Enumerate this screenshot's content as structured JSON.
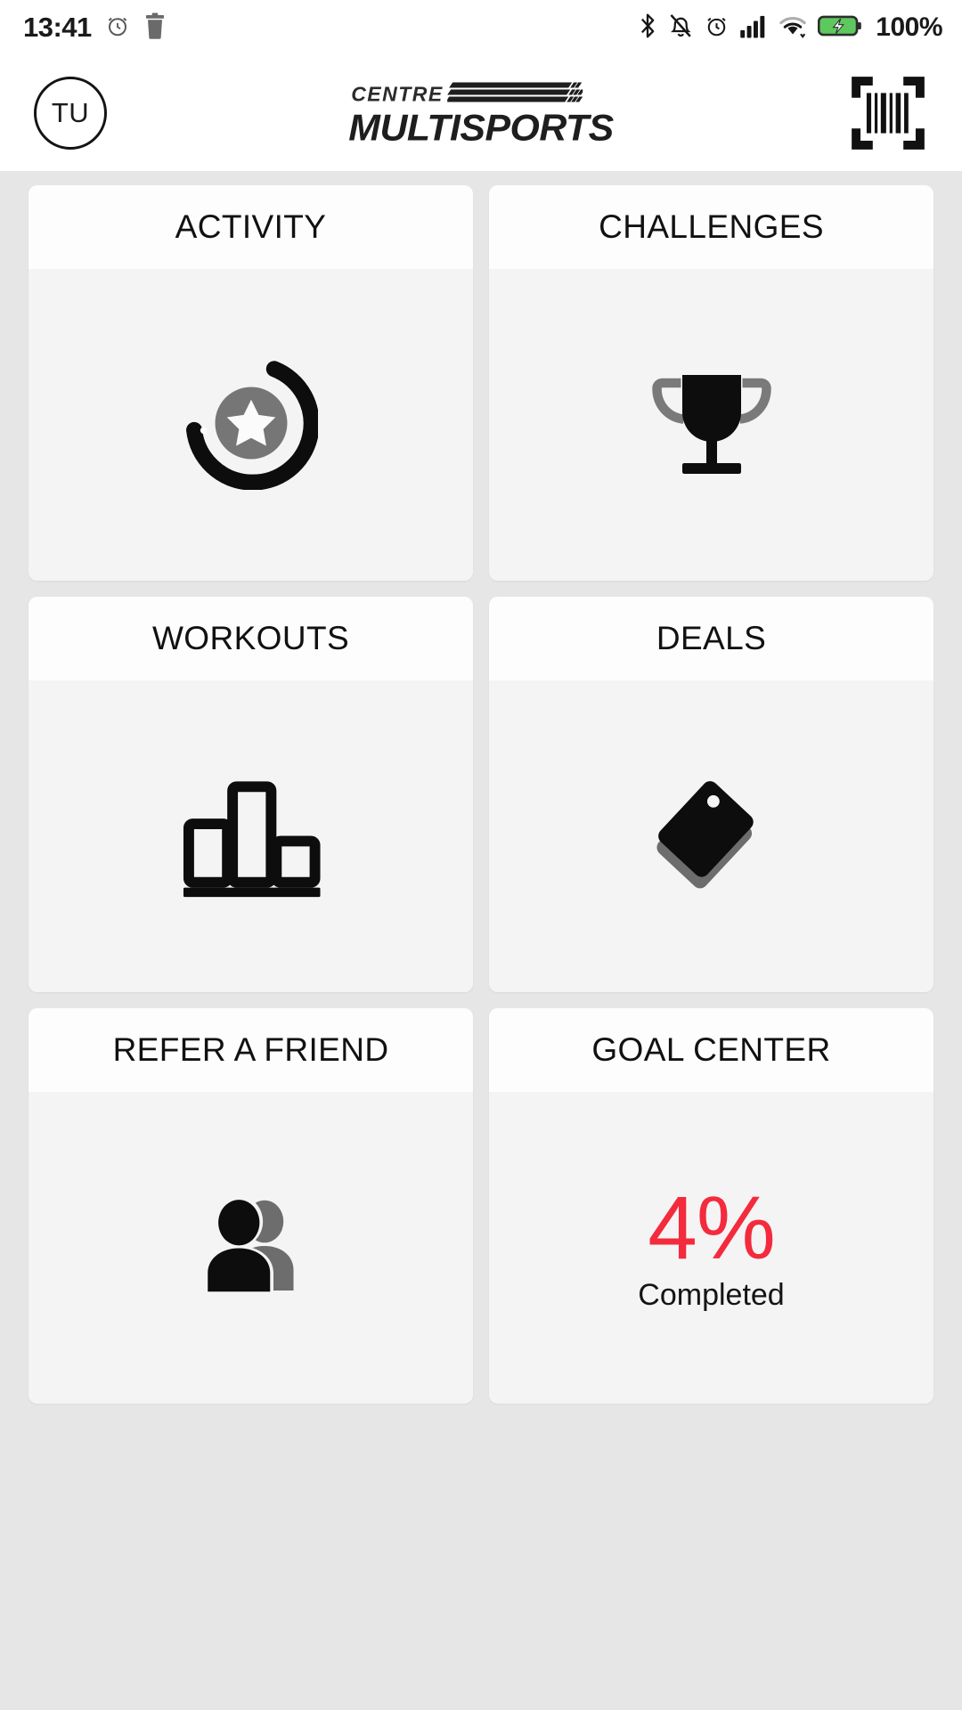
{
  "status_bar": {
    "time": "13:41",
    "battery_percent": "100%",
    "left_icons": [
      "alarm-icon",
      "trash-icon"
    ],
    "right_icons": [
      "bluetooth-icon",
      "mute-icon",
      "alarm-icon",
      "cellular-signal-icon",
      "wifi-icon",
      "battery-charging-icon"
    ]
  },
  "header": {
    "avatar_initials": "TU",
    "brand_line1": "CENTRE",
    "brand_line2": "MULTISPORTS",
    "scan_icon": "barcode-scan-icon"
  },
  "tiles": [
    {
      "title": "ACTIVITY",
      "icon": "activity-ring-star-icon"
    },
    {
      "title": "CHALLENGES",
      "icon": "trophy-icon"
    },
    {
      "title": "WORKOUTS",
      "icon": "bar-chart-icon"
    },
    {
      "title": "DEALS",
      "icon": "price-tag-icon"
    },
    {
      "title": "REFER A FRIEND",
      "icon": "two-people-icon"
    },
    {
      "title": "GOAL CENTER",
      "icon": "goal-percent",
      "percent": "4%",
      "caption": "Completed"
    }
  ],
  "colors": {
    "accent_red": "#f42a3d",
    "page_background": "#e6e6e6",
    "tile_background": "#f4f4f4",
    "tile_header_background": "#fdfdfd",
    "icon_dark": "#111111",
    "icon_gray": "#6e6e6e",
    "battery_green": "#5ec85e"
  }
}
